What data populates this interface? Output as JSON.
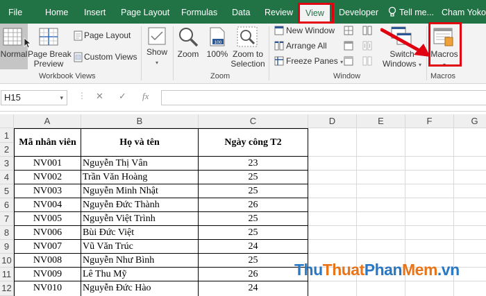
{
  "ribbon_tabs": [
    {
      "label": "File"
    },
    {
      "label": "Home"
    },
    {
      "label": "Insert"
    },
    {
      "label": "Page Layout"
    },
    {
      "label": "Formulas"
    },
    {
      "label": "Data"
    },
    {
      "label": "Review"
    },
    {
      "label": "View"
    },
    {
      "label": "Developer"
    }
  ],
  "tell_me": "Tell me...",
  "user_name": "Cham Yoko",
  "workbook_views": {
    "normal": "Normal",
    "page_break_1": "Page Break",
    "page_break_2": "Preview",
    "page_layout": "Page Layout",
    "custom_views": "Custom Views",
    "group_label": "Workbook Views"
  },
  "show": {
    "label": "Show"
  },
  "zoom": {
    "zoom": "Zoom",
    "hundred": "100%",
    "hundred_icon": "100",
    "sel_1": "Zoom to",
    "sel_2": "Selection",
    "group_label": "Zoom"
  },
  "window": {
    "new_window": "New Window",
    "arrange_all": "Arrange All",
    "freeze_panes": "Freeze Panes",
    "switch_1": "Switch",
    "switch_2": "Windows",
    "group_label": "Window"
  },
  "macros": {
    "label": "Macros",
    "group_label": "Macros"
  },
  "formula_bar": {
    "name_box": "H15",
    "fx": "fx",
    "value": ""
  },
  "columns": [
    "A",
    "B",
    "C",
    "D",
    "E",
    "F",
    "G"
  ],
  "rows": [
    "1",
    "2",
    "3",
    "4",
    "5",
    "6",
    "7",
    "8",
    "9",
    "10",
    "11",
    "12"
  ],
  "table": {
    "headers": [
      "Mã nhân viên",
      "Họ và tên",
      "Ngày công T2"
    ],
    "rows": [
      [
        "NV001",
        "Nguyễn Thị Vân",
        "23"
      ],
      [
        "NV002",
        "Trần Văn Hoàng",
        "25"
      ],
      [
        "NV003",
        "Nguyễn Minh Nhật",
        "25"
      ],
      [
        "NV004",
        "Nguyễn Đức Thành",
        "26"
      ],
      [
        "NV005",
        "Nguyễn Việt Trình",
        "25"
      ],
      [
        "NV006",
        "Bùi Đức Việt",
        "25"
      ],
      [
        "NV007",
        "Vũ Văn Trúc",
        "24"
      ],
      [
        "NV008",
        "Nguyễn Như Bình",
        "25"
      ],
      [
        "NV009",
        "Lê Thu Mỹ",
        "26"
      ],
      [
        "NV010",
        "Nguyễn Đức Hào",
        "24"
      ]
    ]
  },
  "watermark": {
    "part1": "Thu",
    "part2": "Thuat",
    "part3": "Phan",
    "part4": "Mem",
    "part5": ".vn"
  },
  "colors": {
    "ribbon_green": "#217346",
    "highlight_red": "#e0000f"
  }
}
